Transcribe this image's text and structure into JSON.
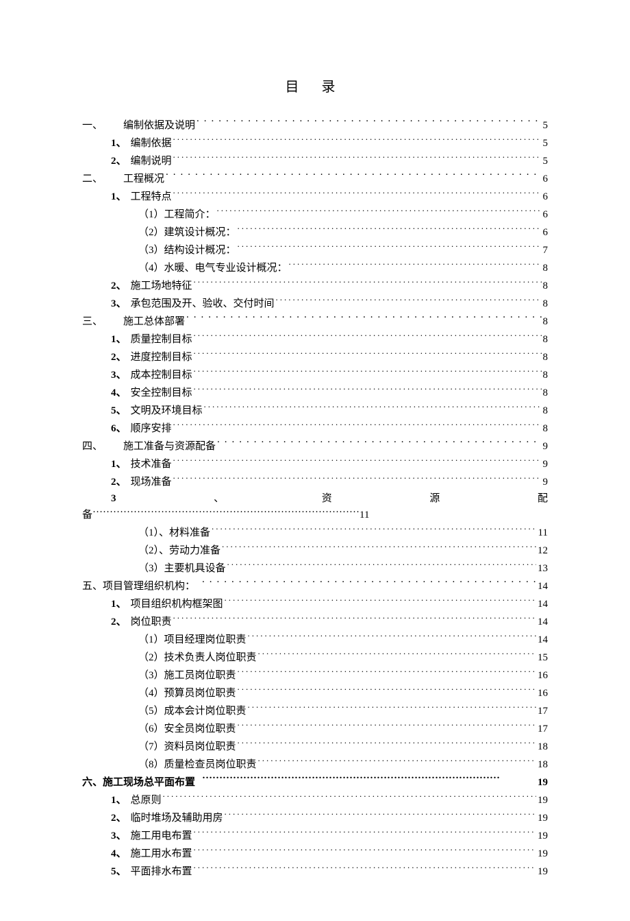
{
  "title": "目 录",
  "entries": [
    {
      "level": 1,
      "num": "一、",
      "label": "编制依据及说明",
      "page": "5",
      "leader": "wide"
    },
    {
      "level": 2,
      "num": "1、",
      "label": "编制依据",
      "page": "5"
    },
    {
      "level": 2,
      "num": "2、",
      "label": "编制说明",
      "page": "5"
    },
    {
      "level": 1,
      "num": "二、",
      "label": "工程概况",
      "page": "6",
      "leader": "wide"
    },
    {
      "level": 2,
      "num": "1、",
      "label": "工程特点",
      "page": "6"
    },
    {
      "level": 3,
      "num": "",
      "label": "（1）工程简介：",
      "page": "6"
    },
    {
      "level": 3,
      "num": "",
      "label": "（2）建筑设计概况：",
      "page": "6"
    },
    {
      "level": 3,
      "num": "",
      "label": "（3）结构设计概况：",
      "page": "7"
    },
    {
      "level": 3,
      "num": "",
      "label": "（4）水暖、电气专业设计概况：",
      "page": "8"
    },
    {
      "level": 2,
      "num": "2、",
      "label": "施工场地特征",
      "page": "8"
    },
    {
      "level": 2,
      "num": "3、",
      "label": "承包范围及开、验收、交付时间",
      "page": "8"
    },
    {
      "level": 1,
      "num": "三、",
      "label": "施工总体部署",
      "page": "8",
      "leader": "wide"
    },
    {
      "level": 2,
      "num": "1、",
      "label": "质量控制目标",
      "page": "8"
    },
    {
      "level": 2,
      "num": "2、",
      "label": "进度控制目标",
      "page": "8"
    },
    {
      "level": 2,
      "num": "3、",
      "label": "成本控制目标",
      "page": "8"
    },
    {
      "level": 2,
      "num": "4、",
      "label": "安全控制目标",
      "page": "8"
    },
    {
      "level": 2,
      "num": "5、",
      "label": "文明及环境目标",
      "page": "8"
    },
    {
      "level": 2,
      "num": "6、",
      "label": "顺序安排",
      "page": "8"
    },
    {
      "level": 1,
      "num": "四、",
      "label": "施工准备与资源配备",
      "page": "9",
      "leader": "wide"
    },
    {
      "level": 2,
      "num": "1、",
      "label": "技术准备",
      "page": "9"
    },
    {
      "level": 2,
      "num": "2、",
      "label": "现场准备",
      "page": "9"
    },
    {
      "level": "special",
      "num": "3",
      "parts": [
        "、",
        "资",
        "源",
        "配"
      ],
      "line2_prefix": "备",
      "page": "11"
    },
    {
      "level": 3,
      "num": "",
      "label": "（1）、材料准备",
      "page": "11"
    },
    {
      "level": 3,
      "num": "",
      "label": "（2）、劳动力准备",
      "page": "12"
    },
    {
      "level": 3,
      "num": "",
      "label": "（3）主要机具设备",
      "page": "13"
    },
    {
      "level": "1b",
      "num": "五、",
      "label": "项目管理组织机构：",
      "page": "14",
      "leader": "wide"
    },
    {
      "level": 2,
      "num": "1、",
      "label": "项目组织机构框架图",
      "page": "14"
    },
    {
      "level": 2,
      "num": "2、",
      "label": "岗位职责",
      "page": "14"
    },
    {
      "level": 3,
      "num": "",
      "label": "（1）项目经理岗位职责",
      "page": "14"
    },
    {
      "level": 3,
      "num": "",
      "label": "（2）技术负责人岗位职责",
      "page": "15"
    },
    {
      "level": 3,
      "num": "",
      "label": "（3）施工员岗位职责",
      "page": "16"
    },
    {
      "level": 3,
      "num": "",
      "label": "（4）预算员岗位职责",
      "page": "16"
    },
    {
      "level": 3,
      "num": "",
      "label": "（5）成本会计岗位职责",
      "page": "17"
    },
    {
      "level": 3,
      "num": "",
      "label": "（6）安全员岗位职责",
      "page": "17"
    },
    {
      "level": 3,
      "num": "",
      "label": "（7）资料员岗位职责",
      "page": "18"
    },
    {
      "level": 3,
      "num": "",
      "label": "（8）质量检查员岗位职责",
      "page": "18"
    },
    {
      "level": "1bold",
      "num": "六、",
      "label": "施工现场总平面布置",
      "page": "19"
    },
    {
      "level": 2,
      "num": "1、",
      "label": "总原则",
      "page": "19"
    },
    {
      "level": 2,
      "num": "2、",
      "label": "临时堆场及辅助用房",
      "page": "19"
    },
    {
      "level": 2,
      "num": "3、",
      "label": "施工用电布置",
      "page": "19"
    },
    {
      "level": 2,
      "num": "4、",
      "label": "施工用水布置",
      "page": "19"
    },
    {
      "level": 2,
      "num": "5、",
      "label": "平面排水布置",
      "page": "19"
    }
  ]
}
